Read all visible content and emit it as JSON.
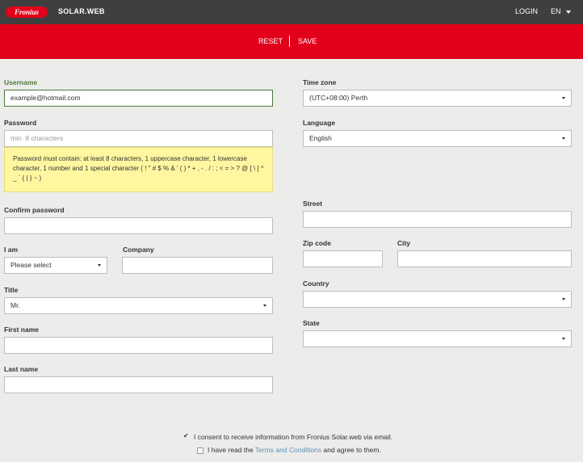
{
  "header": {
    "logo_text": "Fronius",
    "brand": "SOLAR.WEB",
    "login": "LOGIN",
    "language": "EN"
  },
  "actions": {
    "reset": "RESET",
    "save": "SAVE"
  },
  "form": {
    "username": {
      "label": "Username",
      "value": "example@hotmail.com"
    },
    "password": {
      "label": "Password",
      "placeholder": "min. 8 characters",
      "hint": "Password must contain: at least 8 characters, 1 uppercase character, 1 lowercase character, 1 number and 1 special character ( ! \" # $ % & ' ( ) * + , - . / : ; < = > ? @ [ \\ ] ^ _ ` { | } ~ )"
    },
    "confirm_password": {
      "label": "Confirm password",
      "value": ""
    },
    "i_am": {
      "label": "I am",
      "value": "Please select"
    },
    "company": {
      "label": "Company",
      "value": ""
    },
    "title": {
      "label": "Title",
      "value": "Mr."
    },
    "first_name": {
      "label": "First name",
      "value": ""
    },
    "last_name": {
      "label": "Last name",
      "value": ""
    },
    "time_zone": {
      "label": "Time zone",
      "value": "(UTC+08:00) Perth"
    },
    "language": {
      "label": "Language",
      "value": "English"
    },
    "street": {
      "label": "Street",
      "value": ""
    },
    "zip_code": {
      "label": "Zip code",
      "value": ""
    },
    "city": {
      "label": "City",
      "value": ""
    },
    "country": {
      "label": "Country",
      "value": ""
    },
    "state": {
      "label": "State",
      "value": ""
    }
  },
  "consent": {
    "email_info": {
      "text": "I consent to receive information from Fronius Solar.web via email.",
      "checked": true
    },
    "terms": {
      "prefix": "I have read the ",
      "link": "Terms and Conditions",
      "suffix": " and agree to them.",
      "checked": false
    }
  },
  "colors": {
    "brand_red": "#e2001a",
    "topbar": "#3f3f3f",
    "active_green": "#4e7a3a",
    "hint_yellow": "#fff7a0",
    "link_blue": "#5b8fb5"
  }
}
